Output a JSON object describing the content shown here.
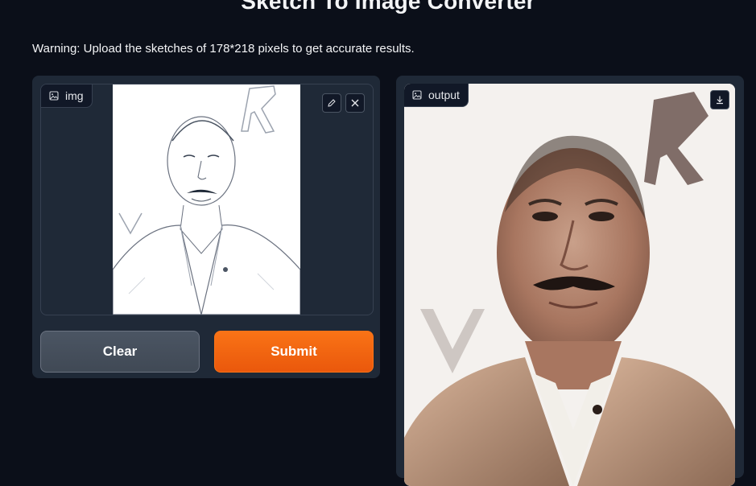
{
  "app": {
    "title": "Sketch To Image Converter",
    "warning": "Warning: Upload the sketches of 178*218 pixels to get accurate results."
  },
  "input_panel": {
    "label": "img",
    "edit_icon": "pencil-icon",
    "clear_icon": "close-icon"
  },
  "buttons": {
    "clear_label": "Clear",
    "submit_label": "Submit"
  },
  "output_panel": {
    "label": "output",
    "download_icon": "download-icon"
  },
  "colors": {
    "background": "#0b0f19",
    "panel": "#1f2937",
    "submit": "#f97316",
    "clear": "#4b5563"
  }
}
